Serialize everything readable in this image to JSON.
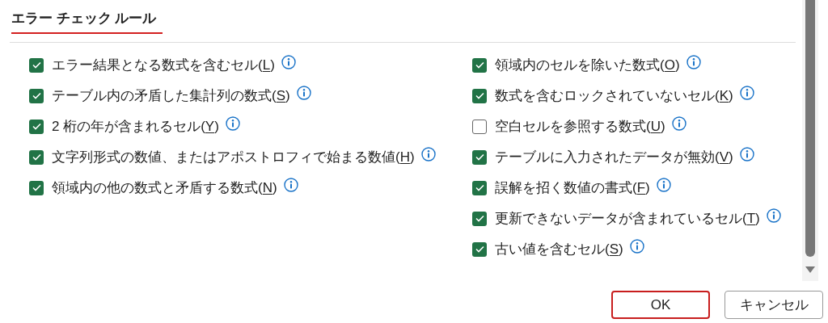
{
  "title": "エラー チェック ルール",
  "columns": [
    {
      "rules": [
        {
          "text_before": "エラー結果となる数式を含むセル(",
          "access_key": "L",
          "text_after": ")",
          "checked": true
        },
        {
          "text_before": "テーブル内の矛盾した集計列の数式(",
          "access_key": "S",
          "text_after": ")",
          "checked": true
        },
        {
          "text_before": "2 桁の年が含まれるセル(",
          "access_key": "Y",
          "text_after": ")",
          "checked": true
        },
        {
          "text_before": "文字列形式の数値、またはアポストロフィで始まる数値(",
          "access_key": "H",
          "text_after": ")",
          "checked": true
        },
        {
          "text_before": "領域内の他の数式と矛盾する数式(",
          "access_key": "N",
          "text_after": ")",
          "checked": true
        }
      ]
    },
    {
      "rules": [
        {
          "text_before": "領域内のセルを除いた数式(",
          "access_key": "O",
          "text_after": ")",
          "checked": true
        },
        {
          "text_before": "数式を含むロックされていないセル(",
          "access_key": "K",
          "text_after": ")",
          "checked": true
        },
        {
          "text_before": "空白セルを参照する数式(",
          "access_key": "U",
          "text_after": ")",
          "checked": false
        },
        {
          "text_before": "テーブルに入力されたデータが無効(",
          "access_key": "V",
          "text_after": ")",
          "checked": true
        },
        {
          "text_before": "誤解を招く数値の書式(",
          "access_key": "F",
          "text_after": ")",
          "checked": true
        },
        {
          "text_before": "更新できないデータが含まれているセル(",
          "access_key": "T",
          "text_after": ")",
          "checked": true
        },
        {
          "text_before": "古い値を含むセル(",
          "access_key": "S",
          "text_after": ")",
          "checked": true
        }
      ]
    }
  ],
  "buttons": [
    {
      "label": "OK",
      "focused": true
    },
    {
      "label": "キャンセル",
      "focused": false
    }
  ]
}
